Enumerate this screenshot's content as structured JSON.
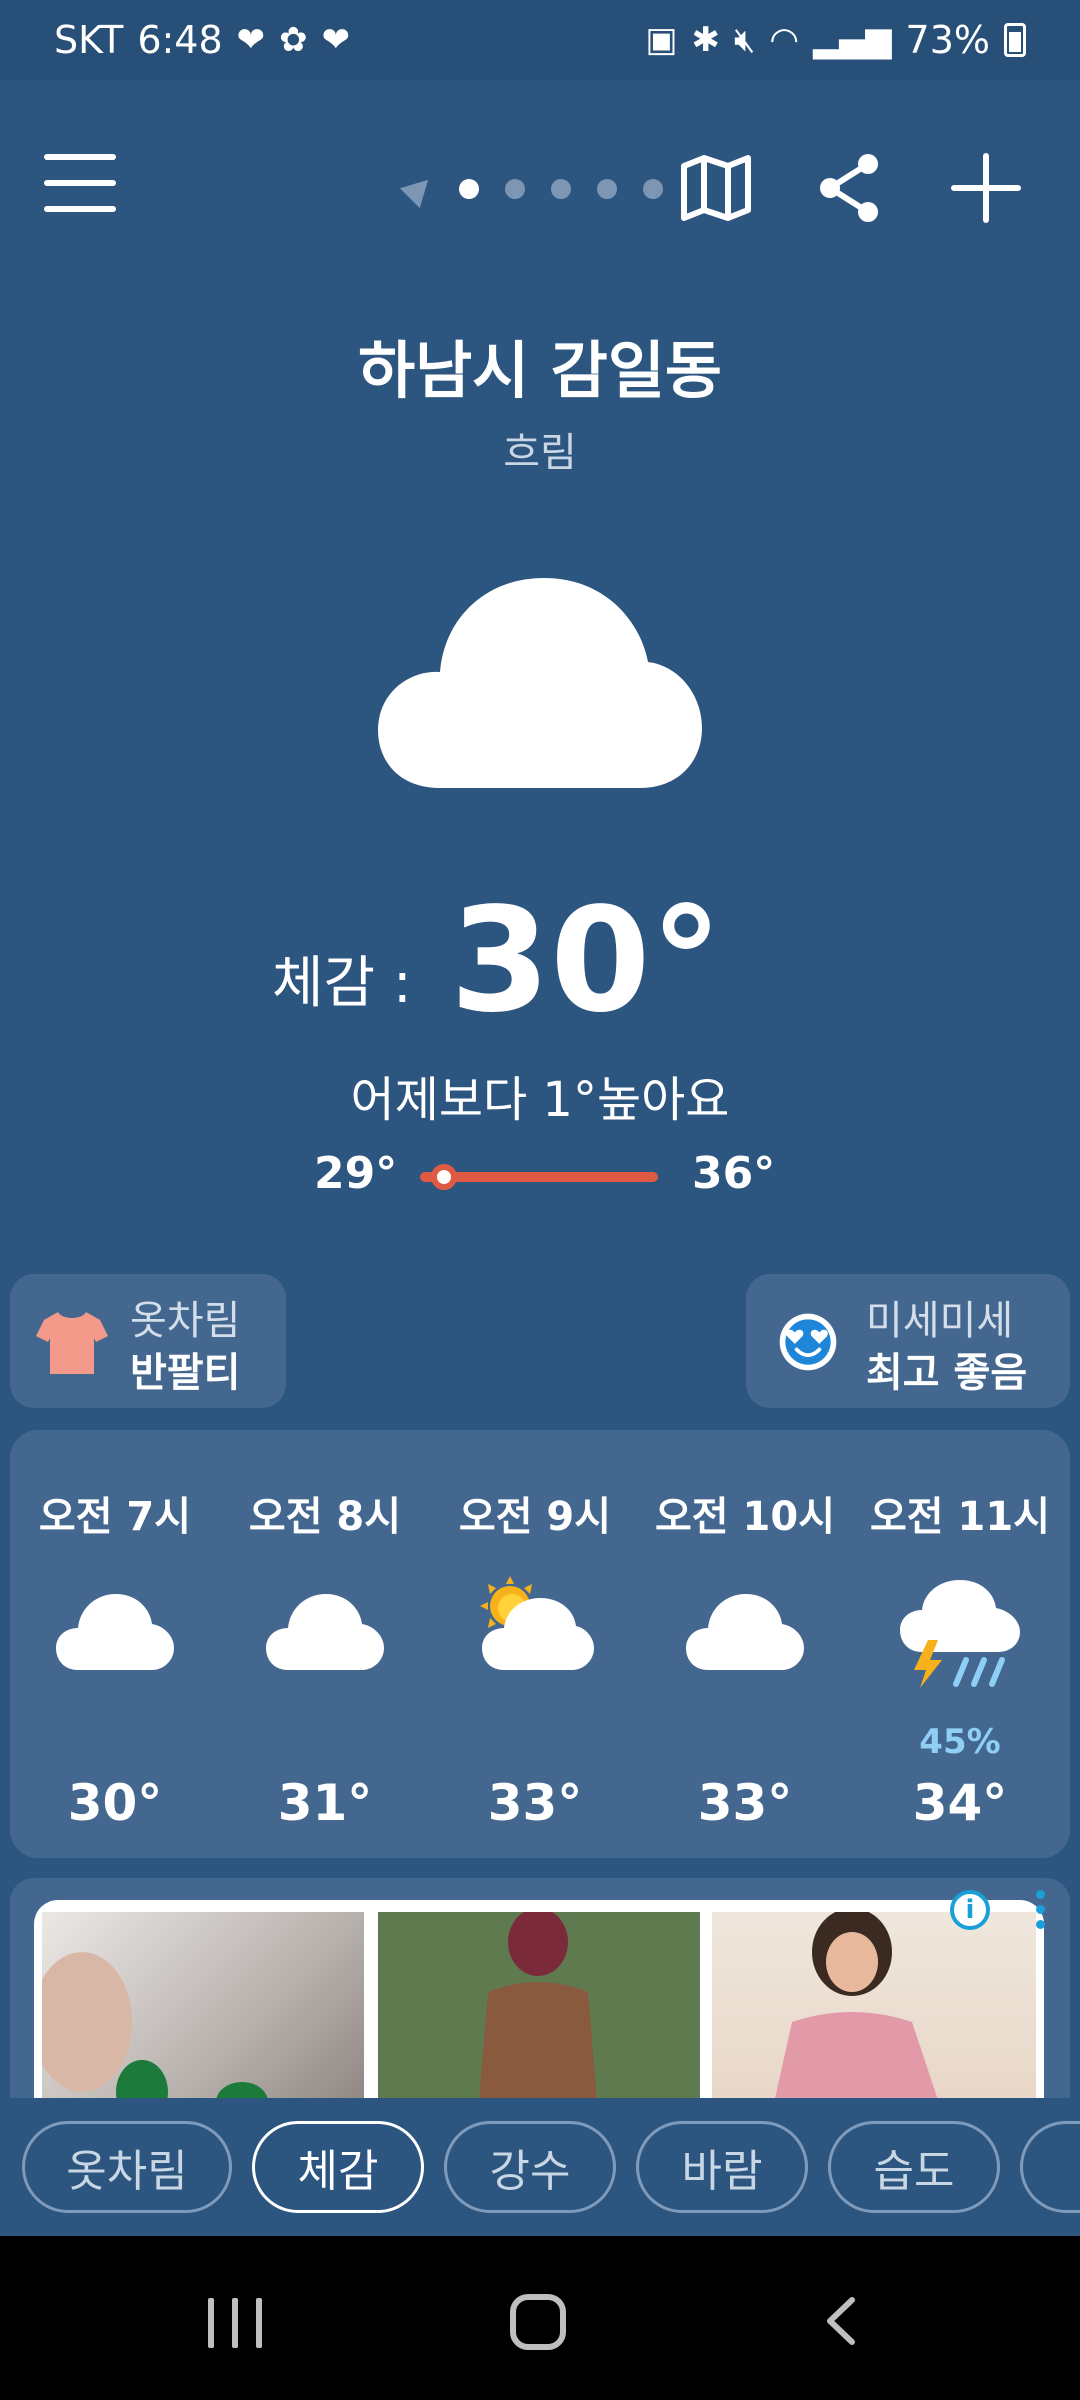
{
  "status_bar": {
    "carrier": "SKT",
    "time": "6:48",
    "battery": "73%"
  },
  "toolbar": {
    "page_count": 5,
    "active_page": 1
  },
  "location": {
    "name": "하남시 감일동",
    "condition": "흐림"
  },
  "current": {
    "feels_label": "체감 :",
    "feels_value": "30°",
    "compare_text": "어제보다 1°높아요",
    "min": "29°",
    "max": "36°",
    "current_position": 0.1
  },
  "cards": {
    "outfit": {
      "title": "옷차림",
      "value": "반팔티"
    },
    "dust": {
      "title": "미세미세",
      "value": "최고 좋음"
    }
  },
  "hourly": [
    {
      "time": "오전 7시",
      "icon": "cloud-icon",
      "precip": "",
      "temp": "30°"
    },
    {
      "time": "오전 8시",
      "icon": "cloud-icon",
      "precip": "",
      "temp": "31°"
    },
    {
      "time": "오전 9시",
      "icon": "partly-sunny-icon",
      "precip": "",
      "temp": "33°"
    },
    {
      "time": "오전 10시",
      "icon": "cloud-icon",
      "precip": "",
      "temp": "33°"
    },
    {
      "time": "오전 11시",
      "icon": "thunder-rain-icon",
      "precip": "45%",
      "temp": "34°"
    }
  ],
  "tabs": [
    "옷차림",
    "체감",
    "강수",
    "바람",
    "습도"
  ],
  "active_tab": "체감",
  "colors": {
    "background": "#2c5580",
    "card": "#44678f",
    "accent_red": "#e05a43",
    "precip_blue": "#8fcff5"
  }
}
